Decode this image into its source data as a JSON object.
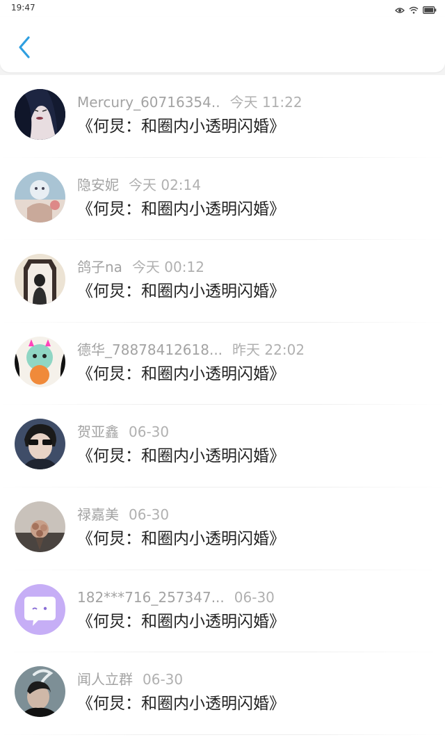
{
  "status_bar": {
    "time": "19:47",
    "icons": [
      "eye-icon",
      "wifi-icon",
      "battery-icon"
    ]
  },
  "header": {
    "back_icon": "chevron-left-icon",
    "accent": "#2f9fe0"
  },
  "comments": [
    {
      "username": "Mercury_60716354..",
      "time": "今天 11:22",
      "text": "《何炅：和圈内小透明闪婚》",
      "avatar": "dark-hair-portrait"
    },
    {
      "username": "隐安妮",
      "time": "今天 02:14",
      "text": "《何炅：和圈内小透明闪婚》",
      "avatar": "illustrated-animal"
    },
    {
      "username": "鸽子na",
      "time": "今天 00:12",
      "text": "《何炅：和圈内小透明闪婚》",
      "avatar": "mirror-selfie"
    },
    {
      "username": "德华_78878412618...",
      "time": "昨天 22:02",
      "text": "《何炅：和圈内小透明闪婚》",
      "avatar": "cartoon-dragon"
    },
    {
      "username": "贺亚鑫",
      "time": "06-30",
      "text": "《何炅：和圈内小透明闪婚》",
      "avatar": "sunglasses-person"
    },
    {
      "username": "禄嘉美",
      "time": "06-30",
      "text": "《何炅：和圈内小透明闪婚》",
      "avatar": "flower-bouquet"
    },
    {
      "username": "182***716_257347...",
      "time": "06-30",
      "text": "《何炅：和圈内小透明闪婚》",
      "avatar": "default-chat-bubble"
    },
    {
      "username": "闻人立群",
      "time": "06-30",
      "text": "《何炅：和圈内小透明闪婚》",
      "avatar": "smoking-person"
    }
  ]
}
